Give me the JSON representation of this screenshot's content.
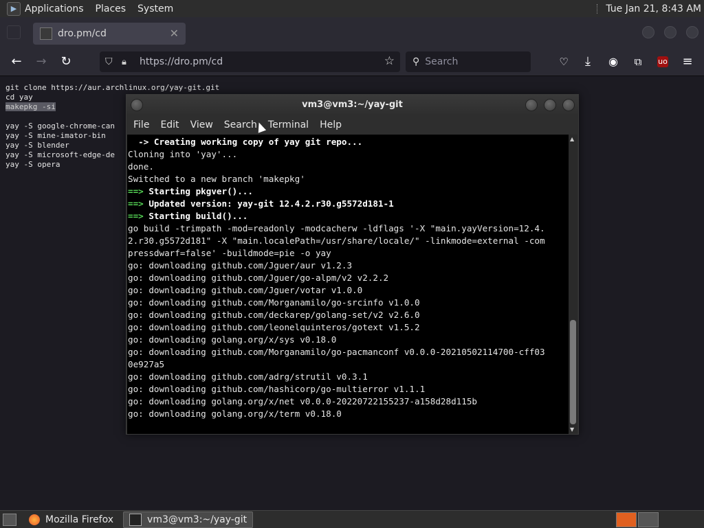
{
  "top_panel": {
    "menus": [
      "Applications",
      "Places",
      "System"
    ],
    "clock": "Tue Jan 21,  8:43 AM"
  },
  "browser": {
    "tab_title": "dro.pm/cd",
    "url": "https://dro.pm/cd",
    "search_placeholder": "Search"
  },
  "page": {
    "lines": [
      "git clone https://aur.archlinux.org/yay-git.git",
      "cd yay",
      "makepkg -si",
      "",
      "yay -S google-chrome-can",
      "yay -S mine-imator-bin",
      "yay -S blender",
      "yay -S microsoft-edge-de",
      "yay -S opera"
    ]
  },
  "terminal": {
    "title": "vm3@vm3:~/yay-git",
    "menu": [
      "File",
      "Edit",
      "View",
      "Search",
      "Terminal",
      "Help"
    ],
    "output": [
      {
        "style": "b",
        "text": "  -> Creating working copy of yay git repo..."
      },
      {
        "style": "",
        "text": "Cloning into 'yay'..."
      },
      {
        "style": "",
        "text": "done."
      },
      {
        "style": "",
        "text": "Switched to a new branch 'makepkg'"
      },
      {
        "style": "arrow",
        "arrow": "==>",
        "text": " Starting pkgver()..."
      },
      {
        "style": "arrow",
        "arrow": "==>",
        "text": " Updated version: yay-git 12.4.2.r30.g5572d181-1"
      },
      {
        "style": "arrow",
        "arrow": "==>",
        "text": " Starting build()..."
      },
      {
        "style": "",
        "text": "go build -trimpath -mod=readonly -modcacherw -ldflags '-X \"main.yayVersion=12.4."
      },
      {
        "style": "",
        "text": "2.r30.g5572d181\" -X \"main.localePath=/usr/share/locale/\" -linkmode=external -com"
      },
      {
        "style": "",
        "text": "pressdwarf=false' -buildmode=pie -o yay"
      },
      {
        "style": "",
        "text": "go: downloading github.com/Jguer/aur v1.2.3"
      },
      {
        "style": "",
        "text": "go: downloading github.com/Jguer/go-alpm/v2 v2.2.2"
      },
      {
        "style": "",
        "text": "go: downloading github.com/Jguer/votar v1.0.0"
      },
      {
        "style": "",
        "text": "go: downloading github.com/Morganamilo/go-srcinfo v1.0.0"
      },
      {
        "style": "",
        "text": "go: downloading github.com/deckarep/golang-set/v2 v2.6.0"
      },
      {
        "style": "",
        "text": "go: downloading github.com/leonelquinteros/gotext v1.5.2"
      },
      {
        "style": "",
        "text": "go: downloading golang.org/x/sys v0.18.0"
      },
      {
        "style": "",
        "text": "go: downloading github.com/Morganamilo/go-pacmanconf v0.0.0-20210502114700-cff03"
      },
      {
        "style": "",
        "text": "0e927a5"
      },
      {
        "style": "",
        "text": "go: downloading github.com/adrg/strutil v0.3.1"
      },
      {
        "style": "",
        "text": "go: downloading github.com/hashicorp/go-multierror v1.1.1"
      },
      {
        "style": "",
        "text": "go: downloading golang.org/x/net v0.0.0-20220722155237-a158d28d115b"
      },
      {
        "style": "",
        "text": "go: downloading golang.org/x/term v0.18.0"
      }
    ]
  },
  "taskbar": {
    "tasks": [
      {
        "label": "Mozilla Firefox",
        "active": false
      },
      {
        "label": "vm3@vm3:~/yay-git",
        "active": true
      }
    ]
  },
  "colors": {
    "terminal_prompt_arrow": "#55d455",
    "browser_bg": "#2b2a33",
    "page_bg": "#1c1b22"
  }
}
